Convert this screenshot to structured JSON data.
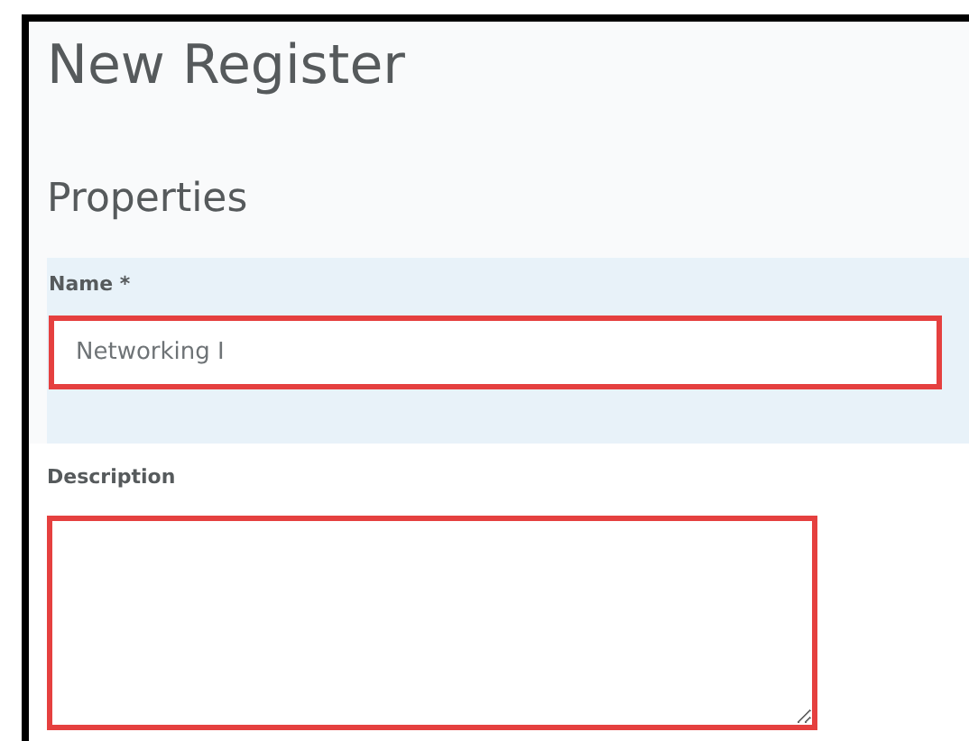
{
  "page": {
    "title": "New Register",
    "section": "Properties"
  },
  "fields": [
    {
      "kind": "input",
      "label": "Name *",
      "value": "Networking I",
      "highlighted": true
    },
    {
      "kind": "textarea",
      "label": "Description",
      "highlighted": true
    }
  ]
}
